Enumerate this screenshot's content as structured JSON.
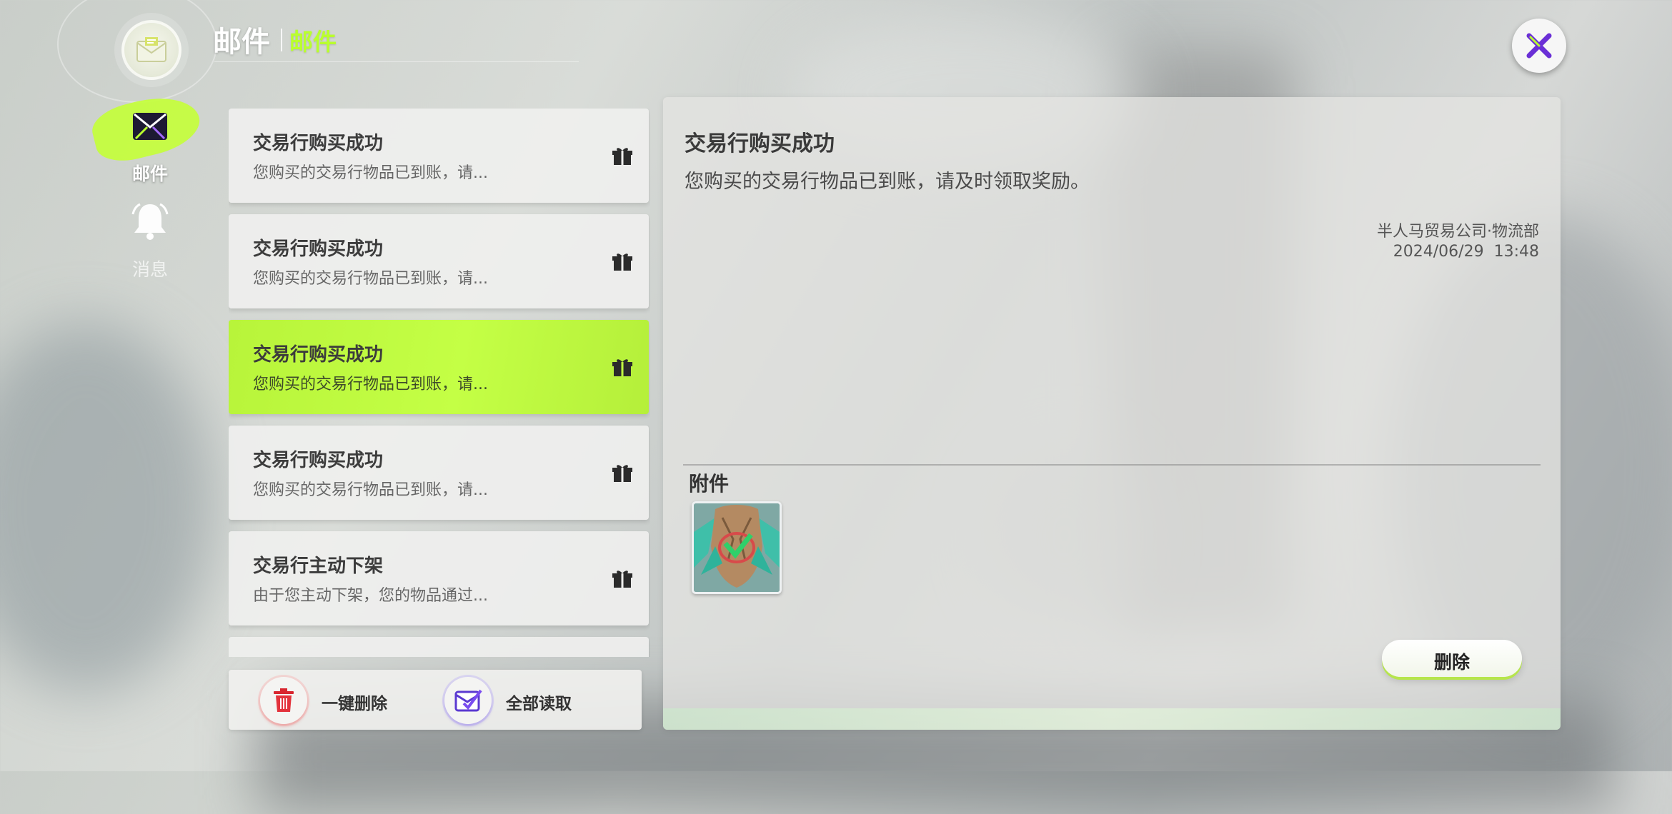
{
  "header": {
    "title": "邮件",
    "subtitle": "邮件"
  },
  "sidebar": {
    "items": [
      {
        "label": "邮件",
        "icon": "mail-tab-icon",
        "selected": true
      },
      {
        "label": "消息",
        "icon": "bell-icon",
        "selected": false
      }
    ]
  },
  "mail_list": {
    "items": [
      {
        "title": "交易行购买成功",
        "preview": "您购买的交易行物品已到账，请...",
        "icon": "gift-icon",
        "selected": false
      },
      {
        "title": "交易行购买成功",
        "preview": "您购买的交易行物品已到账，请...",
        "icon": "gift-icon",
        "selected": false
      },
      {
        "title": "交易行购买成功",
        "preview": "您购买的交易行物品已到账，请...",
        "icon": "gift-icon",
        "selected": true
      },
      {
        "title": "交易行购买成功",
        "preview": "您购买的交易行物品已到账，请...",
        "icon": "gift-icon",
        "selected": false
      },
      {
        "title": "交易行主动下架",
        "preview": "由于您主动下架，您的物品通过...",
        "icon": "gift-icon",
        "selected": false
      }
    ]
  },
  "actions": {
    "delete_all_label": "一键删除",
    "read_all_label": "全部读取"
  },
  "detail": {
    "title": "交易行购买成功",
    "body": "您购买的交易行物品已到账，请及时领取奖励。",
    "sender": "半人马贸易公司·物流部",
    "date": "2024/06/29",
    "time": "13:48",
    "attachment_label": "附件",
    "attachments": [
      {
        "icon": "item-icon"
      }
    ],
    "delete_label": "删除"
  },
  "colors": {
    "accent": "#c4ff45",
    "accent_text": "#b9ff2e",
    "close_icon": "#6a2fd6"
  }
}
